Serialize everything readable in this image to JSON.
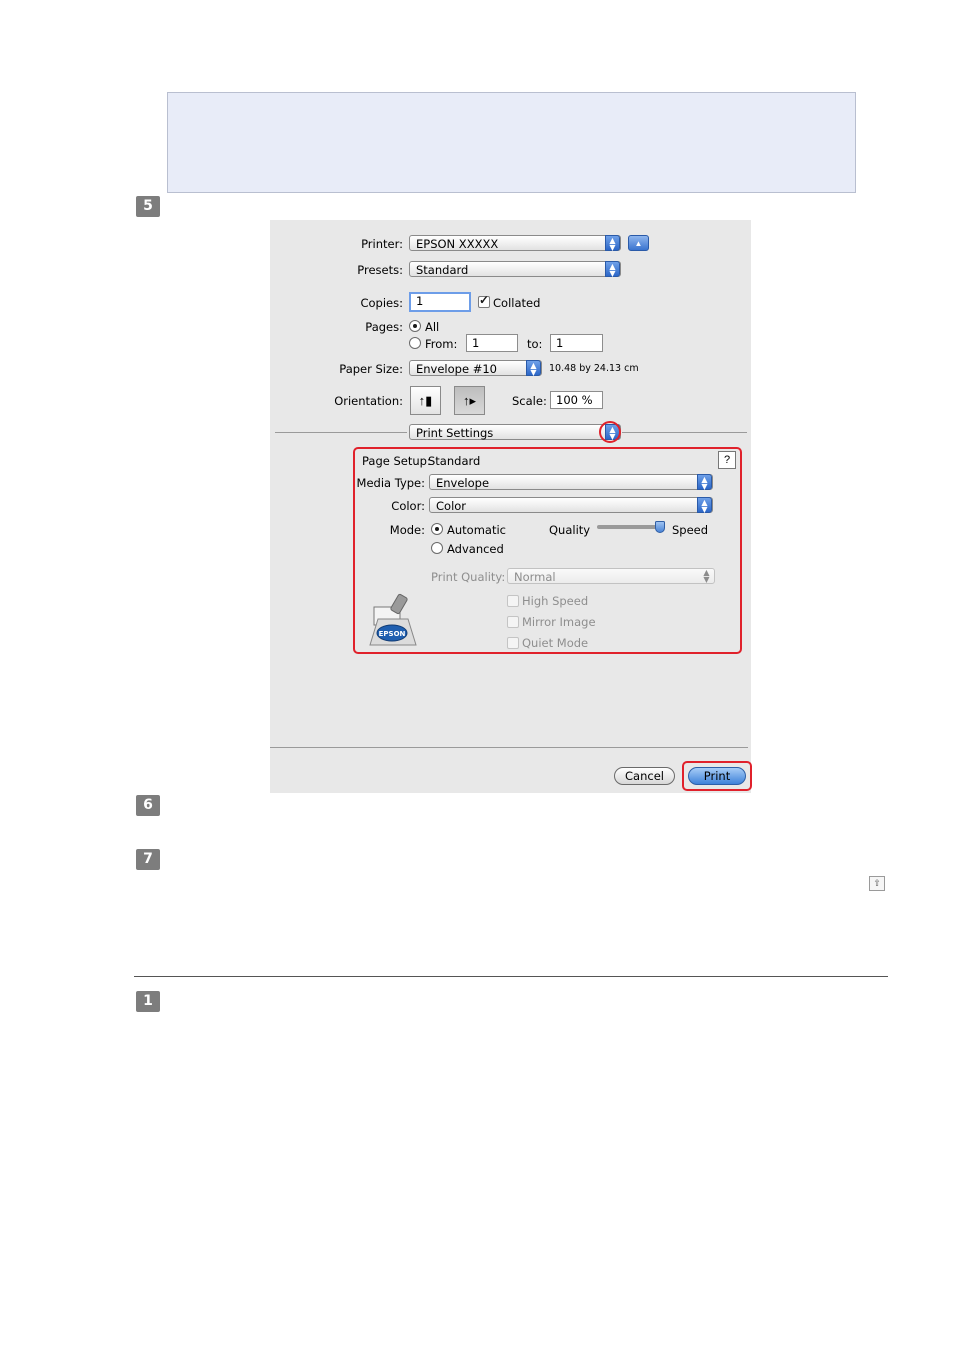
{
  "steps": [
    "5",
    "6",
    "7",
    "1"
  ],
  "dialog": {
    "printer": {
      "label": "Printer:",
      "value": "EPSON XXXXX"
    },
    "presets": {
      "label": "Presets:",
      "value": "Standard"
    },
    "copies": {
      "label": "Copies:",
      "value": "1",
      "collated_label": "Collated"
    },
    "pages": {
      "label": "Pages:",
      "all_label": "All",
      "from_label": "From:",
      "from_value": "1",
      "to_label": "to:",
      "to_value": "1"
    },
    "paper_size": {
      "label": "Paper Size:",
      "value": "Envelope #10",
      "dims": "10.48 by 24.13 cm"
    },
    "orientation": {
      "label": "Orientation:"
    },
    "scale": {
      "label": "Scale:",
      "value": "100 %"
    },
    "panel_menu": "Print Settings",
    "settings": {
      "page_setup_label": "Page Setup:",
      "page_setup_value": "Standard",
      "media_type_label": "Media Type:",
      "media_type_value": "Envelope",
      "color_label": "Color:",
      "color_value": "Color",
      "mode_label": "Mode:",
      "automatic_label": "Automatic",
      "advanced_label": "Advanced",
      "quality_label": "Quality",
      "speed_label": "Speed",
      "print_quality_label": "Print Quality:",
      "print_quality_value": "Normal",
      "high_speed_label": "High Speed",
      "mirror_image_label": "Mirror Image",
      "quiet_mode_label": "Quiet Mode",
      "logo_text": "EPSON"
    },
    "cancel_label": "Cancel",
    "print_label": "Print"
  },
  "colors": {
    "highlight": "#e0212b",
    "accent": "#3e82d9",
    "note_bg": "#e8ecf8"
  }
}
